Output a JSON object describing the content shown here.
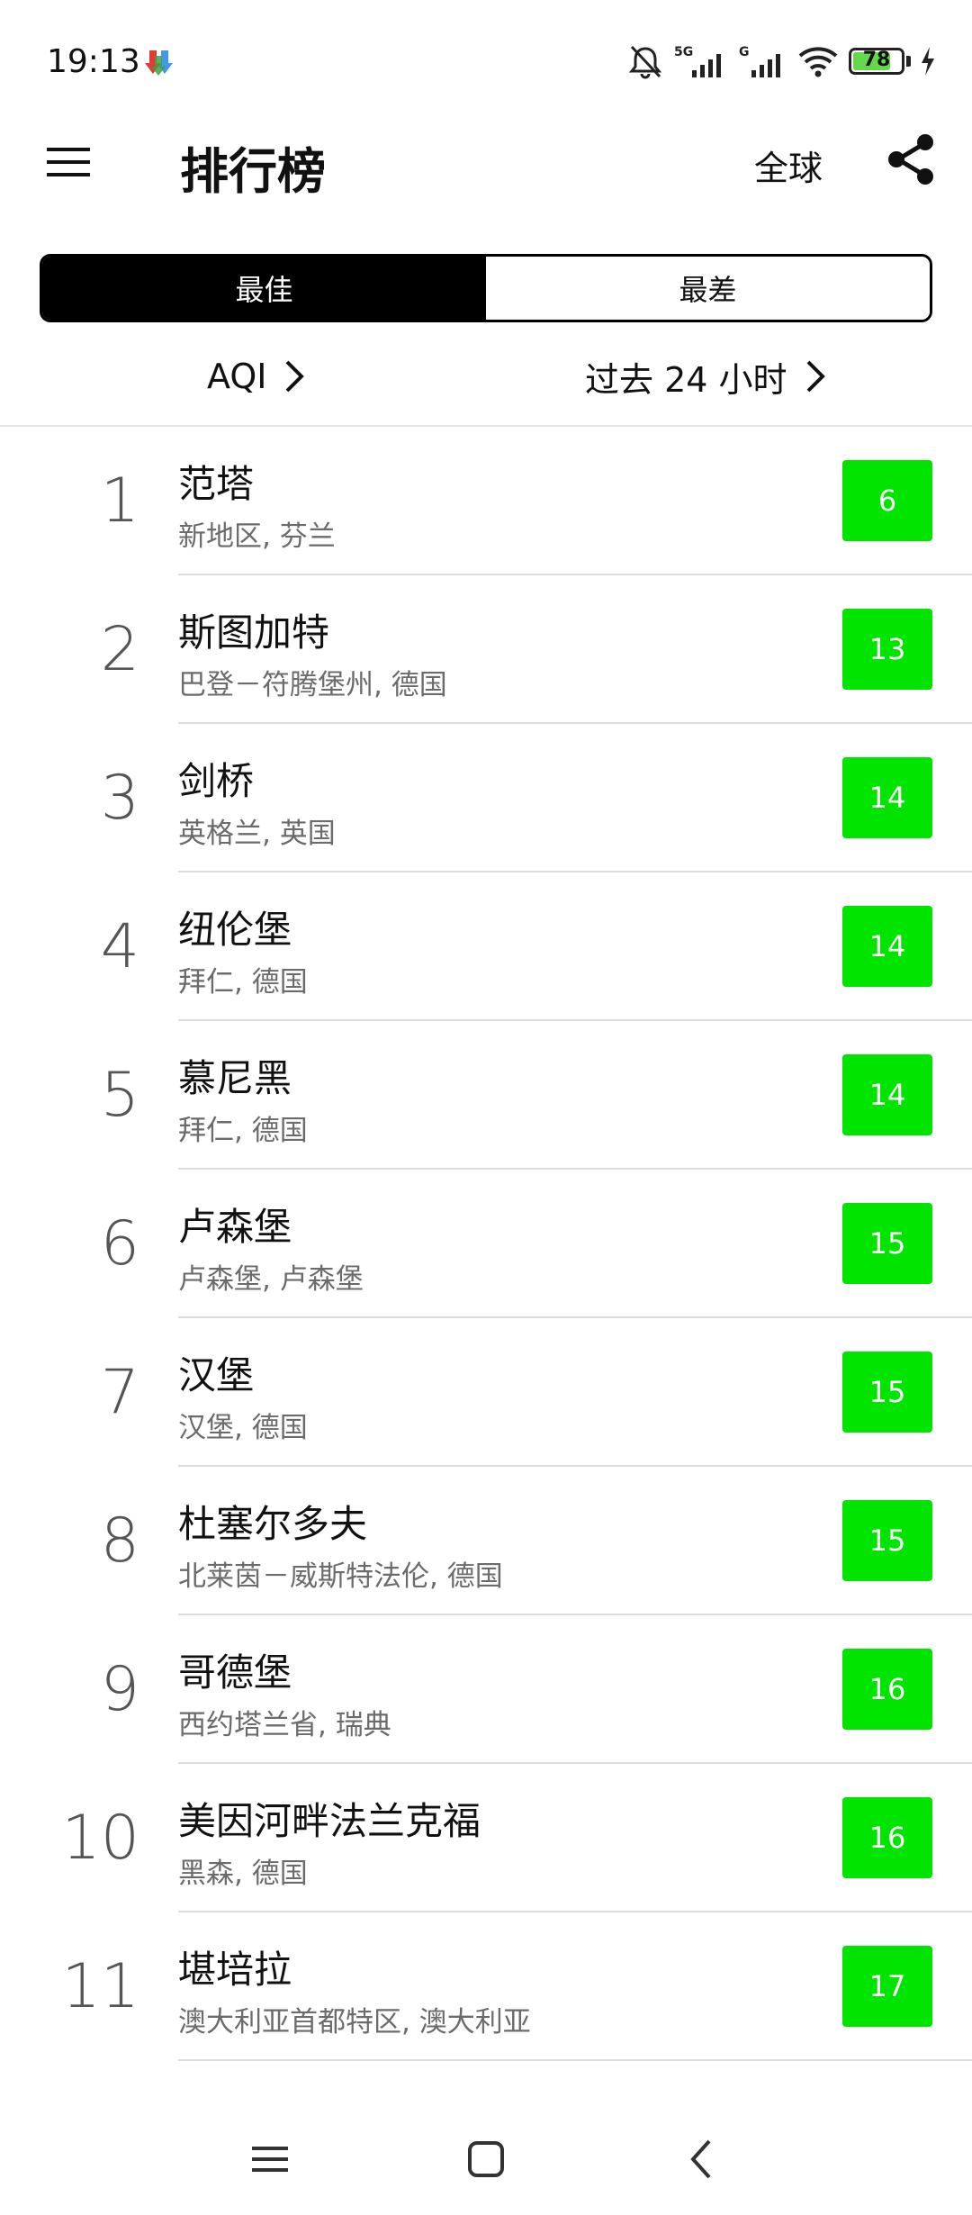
{
  "status_bar": {
    "time": "19:13",
    "battery": "78",
    "battery_level": 0.78,
    "icons": [
      "download-app-icon",
      "mute-icon",
      "5g-signal-icon",
      "g-signal-icon",
      "wifi-icon",
      "battery-icon",
      "charging-icon"
    ]
  },
  "header": {
    "title": "排行榜",
    "region": "全球",
    "menu_icon": "hamburger-menu-icon",
    "share_icon": "share-icon"
  },
  "segmented": {
    "best": "最佳",
    "worst": "最差",
    "selected": "best"
  },
  "filters": {
    "metric": "AQI",
    "period": "过去 24 小时"
  },
  "colors": {
    "good": "#00e400",
    "active_segment": "#000000"
  },
  "rankings": [
    {
      "rank": "1",
      "city": "范塔",
      "region": "新地区, 芬兰",
      "aqi": "6"
    },
    {
      "rank": "2",
      "city": "斯图加特",
      "region": "巴登－符腾堡州, 德国",
      "aqi": "13"
    },
    {
      "rank": "3",
      "city": "剑桥",
      "region": "英格兰, 英国",
      "aqi": "14"
    },
    {
      "rank": "4",
      "city": "纽伦堡",
      "region": "拜仁, 德国",
      "aqi": "14"
    },
    {
      "rank": "5",
      "city": "慕尼黑",
      "region": "拜仁, 德国",
      "aqi": "14"
    },
    {
      "rank": "6",
      "city": "卢森堡",
      "region": "卢森堡, 卢森堡",
      "aqi": "15"
    },
    {
      "rank": "7",
      "city": "汉堡",
      "region": "汉堡, 德国",
      "aqi": "15"
    },
    {
      "rank": "8",
      "city": "杜塞尔多夫",
      "region": "北莱茵－威斯特法伦, 德国",
      "aqi": "15"
    },
    {
      "rank": "9",
      "city": "哥德堡",
      "region": "西约塔兰省, 瑞典",
      "aqi": "16"
    },
    {
      "rank": "10",
      "city": "美因河畔法兰克福",
      "region": "黑森, 德国",
      "aqi": "16"
    },
    {
      "rank": "11",
      "city": "堪培拉",
      "region": "澳大利亚首都特区, 澳大利亚",
      "aqi": "17"
    }
  ],
  "nav": [
    "recent-apps-icon",
    "home-icon",
    "back-icon"
  ]
}
